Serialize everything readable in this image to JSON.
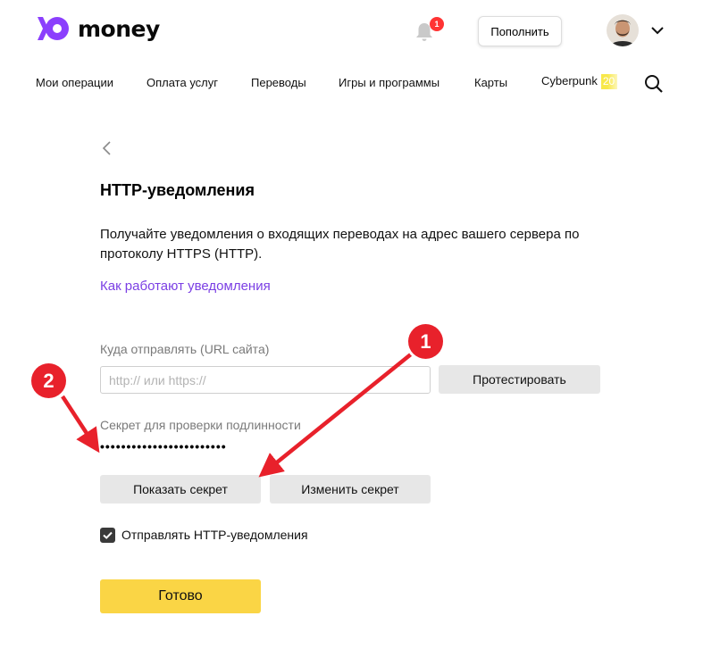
{
  "header": {
    "logo_text": "money",
    "notification_count": "1",
    "topup_label": "Пополнить"
  },
  "nav": {
    "items": [
      "Мои операции",
      "Оплата услуг",
      "Переводы",
      "Игры и программы",
      "Карты",
      "Cyberpunk"
    ],
    "cyberpunk_badge": "20"
  },
  "page": {
    "title": "HTTP-уведомления",
    "description": "Получайте уведомления о входящих переводах на адрес вашего сервера по протоколу HTTPS (HTTP).",
    "how_link": "Как работают уведомления"
  },
  "form": {
    "url_label": "Куда отправлять (URL сайта)",
    "url_value": "",
    "url_placeholder": "http:// или https://",
    "test_button": "Протестировать",
    "secret_label": "Секрет для проверки подлинности",
    "secret_value": "••••••••••••••••••••••••",
    "show_secret_button": "Показать секрет",
    "change_secret_button": "Изменить секрет",
    "send_checkbox_label": "Отправлять HTTP-уведомления",
    "send_checkbox_checked": true,
    "done_button": "Готово"
  },
  "annotations": {
    "marker_1": "1",
    "marker_2": "2"
  },
  "colors": {
    "brand_purple": "#7b3fe4",
    "accent_yellow": "#fad545",
    "badge_red": "#f33",
    "annotation_red": "#e8212b"
  }
}
